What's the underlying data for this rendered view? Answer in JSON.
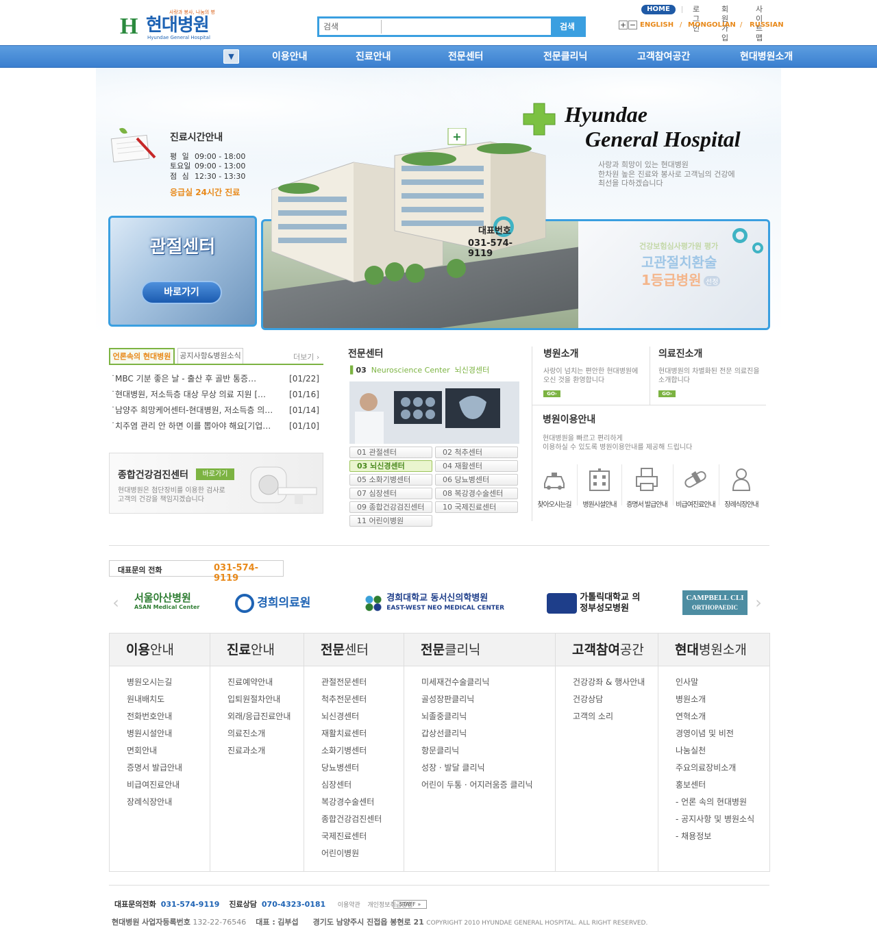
{
  "header": {
    "logo": {
      "name": "현대병원",
      "english": "Hyundae General Hospital",
      "slogan": "사랑과 봉사, 나눔의 병원"
    },
    "search": {
      "category": "검색",
      "placeholder": "",
      "button": "검색"
    },
    "top_links": {
      "home": "HOME",
      "login": "로그인",
      "join": "회원가입",
      "sitemap": "사이트맵"
    },
    "zoom": {
      "in": "+",
      "out": "−"
    },
    "languages": [
      "ENGLISH",
      "MONGOLIAN",
      "RUSSIAN"
    ],
    "lang_sep": "/"
  },
  "nav": {
    "dropdown_icon": "chevron-down-icon",
    "items": [
      "이용안내",
      "진료안내",
      "전문센터",
      "전문클리닉",
      "고객참여공간",
      "현대병원소개"
    ]
  },
  "hero": {
    "hours": {
      "title": "진료시간안내",
      "rows": [
        {
          "day": "평 일",
          "time": "09:00 - 18:00"
        },
        {
          "day": "토요일",
          "time": "09:00 - 13:00"
        },
        {
          "day": "점 심",
          "time": "12:30 - 13:30"
        }
      ],
      "emergency": "응급실 24시간 진료"
    },
    "joint_center": {
      "title": "관절센터",
      "button": "바로가기"
    },
    "hospital_name": [
      "Hyundae",
      "General Hospital"
    ],
    "tagline": [
      "사랑과 희망이 있는 현대병원",
      "한차원 높은 진료와 봉사로 고객님의 건강에",
      "최선을 다하겠습니다"
    ],
    "promo": {
      "line1": "건강보험심사평가원 평가",
      "line2": "고관절치환술",
      "line3": "1등급병원",
      "badge": "선정"
    },
    "rep_label": "대표번호",
    "rep_number": "031-574-9119"
  },
  "news": {
    "tabs": [
      "언론속의 현대병원",
      "공지사항&병원소식"
    ],
    "more": "더보기",
    "items": [
      {
        "title": "MBC 기분 좋은 날 - 출산 후 골반 통증…",
        "date": "[01/22]"
      },
      {
        "title": "현대병원, 저소득층 대상 무상 의료 지원 […",
        "date": "[01/16]"
      },
      {
        "title": "남양주 희망케어센터-현대병원, 저소득층 의…",
        "date": "[01/14]"
      },
      {
        "title": "치주염 관리 안 하면 이를 뽑아야 해요[기업…",
        "date": "[01/10]"
      }
    ]
  },
  "checkup": {
    "title": "종합건강검진센터",
    "button": "바로가기",
    "desc": [
      "현대병원은 첨단장비를 이용한 검사로",
      "고객의 건강을 책임지겠습니다"
    ]
  },
  "specialty": {
    "title": "전문센터",
    "sub_num": "03",
    "sub_en": "Neuroscience Center",
    "sub_ko": "뇌신경센터",
    "buttons": [
      "01 관절센터",
      "02 척추센터",
      "03 뇌신경센터",
      "04 재활센터",
      "05 소화기병센터",
      "06 당뇨병센터",
      "07 심장센터",
      "08 복강경수술센터",
      "09 종합건강검진센터",
      "10 국제진료센터",
      "11 어린이병원"
    ]
  },
  "intro": {
    "hospital": {
      "title": "병원소개",
      "desc": [
        "사랑이 넘치는 편안한 현대병원에",
        "오신 것을 환영합니다"
      ],
      "go": "GO"
    },
    "staff": {
      "title": "의료진소개",
      "desc": [
        "현대병원의 차별화된 전문 의료진을",
        "소개합니다"
      ],
      "go": "GO"
    }
  },
  "guide": {
    "title": "병원이용안내",
    "desc": [
      "현대병원을 빠르고 편리하게",
      "이용하실 수 있도록 병원이용안내를 제공해 드립니다"
    ],
    "icons": [
      {
        "label": "찾아오시는길",
        "icon": "taxi-icon"
      },
      {
        "label": "병원시설안내",
        "icon": "building-icon"
      },
      {
        "label": "증명서 발급안내",
        "icon": "printer-icon"
      },
      {
        "label": "비급여진료안내",
        "icon": "pill-icon"
      },
      {
        "label": "장례식장안내",
        "icon": "people-icon"
      }
    ]
  },
  "call": {
    "label": "대표문의 전화",
    "number": "031-574-9119"
  },
  "partners": [
    {
      "name": "서울아산병원",
      "sub": "ASAN Medical Center",
      "color": "#2e7d32"
    },
    {
      "name": "경희의료원",
      "sub": "",
      "color": "#1e63b4"
    },
    {
      "name": "경희대학교 동서신의학병원",
      "sub": "EAST-WEST NEO MEDICAL CENTER",
      "color": "#1e3e8a"
    },
    {
      "name": "가톨릭대학교 의정부성모병원",
      "sub": "",
      "color": "#222"
    },
    {
      "name": "CAMPBELL CLI",
      "sub": "ORTHOPAEDIC",
      "color": "#fff"
    }
  ],
  "sitemap": [
    {
      "title_b": "이용",
      "title": "안내",
      "links": [
        "병원오시는길",
        "원내배치도",
        "전화번호안내",
        "병원시설안내",
        "면회안내",
        "증명서 발급안내",
        "비급여진료안내",
        "장례식장안내"
      ]
    },
    {
      "title_b": "진료",
      "title": "안내",
      "links": [
        "진료예약안내",
        "입퇴원절차안내",
        "외래/응급진료안내",
        "의료진소개",
        "진료과소개"
      ]
    },
    {
      "title_b": "전문",
      "title": "센터",
      "links": [
        "관절전문센터",
        "척추전문센터",
        "뇌신경센터",
        "재활치료센터",
        "소화기병센터",
        "당뇨병센터",
        "심장센터",
        "복강경수술센터",
        "종합건강검진센터",
        "국제진료센터",
        "어린이병원"
      ]
    },
    {
      "title_b": "전문",
      "title": "클리닉",
      "links": [
        "미세재건수술클리닉",
        "골성장판클리닉",
        "뇌졸중클리닉",
        "갑상선클리닉",
        "항문클리닉",
        "성장 · 발달 클리닉",
        "어린이 두통 · 어지러움증 클리닉"
      ]
    },
    {
      "title_b": "고객참여",
      "title": "공간",
      "links": [
        "건강강좌 & 행사안내",
        "건강상담",
        "고객의 소리"
      ]
    },
    {
      "title_b": "현대",
      "title": "병원소개",
      "links": [
        "인사말",
        "병원소개",
        "연혁소개",
        "경영이념 및 비전",
        "나눔실천",
        "주요의료장비소개",
        "홍보센터",
        "- 언론 속의 현대병원",
        "- 공지사항 및 병원소식",
        "- 채용정보"
      ]
    }
  ],
  "footer": {
    "phone_label": "대표문의전화",
    "phone": "031-574-9119",
    "consult_label": "진료상담",
    "consult": "070-4323-0181",
    "terms": "이용약관",
    "privacy": "개인정보취급방침",
    "staff": "STAFF »",
    "company": "현대병원",
    "biz_label": "사업자등록번호",
    "biz_no": "132-22-76546",
    "ceo_label": "대표 :",
    "ceo": "김부섭",
    "address": "경기도 남양주시 진접읍 봉현로 21",
    "copyright": "COPYRIGHT 2010 HYUNDAE GENERAL HOSPITAL. ALL RIGHT RESERVED."
  }
}
